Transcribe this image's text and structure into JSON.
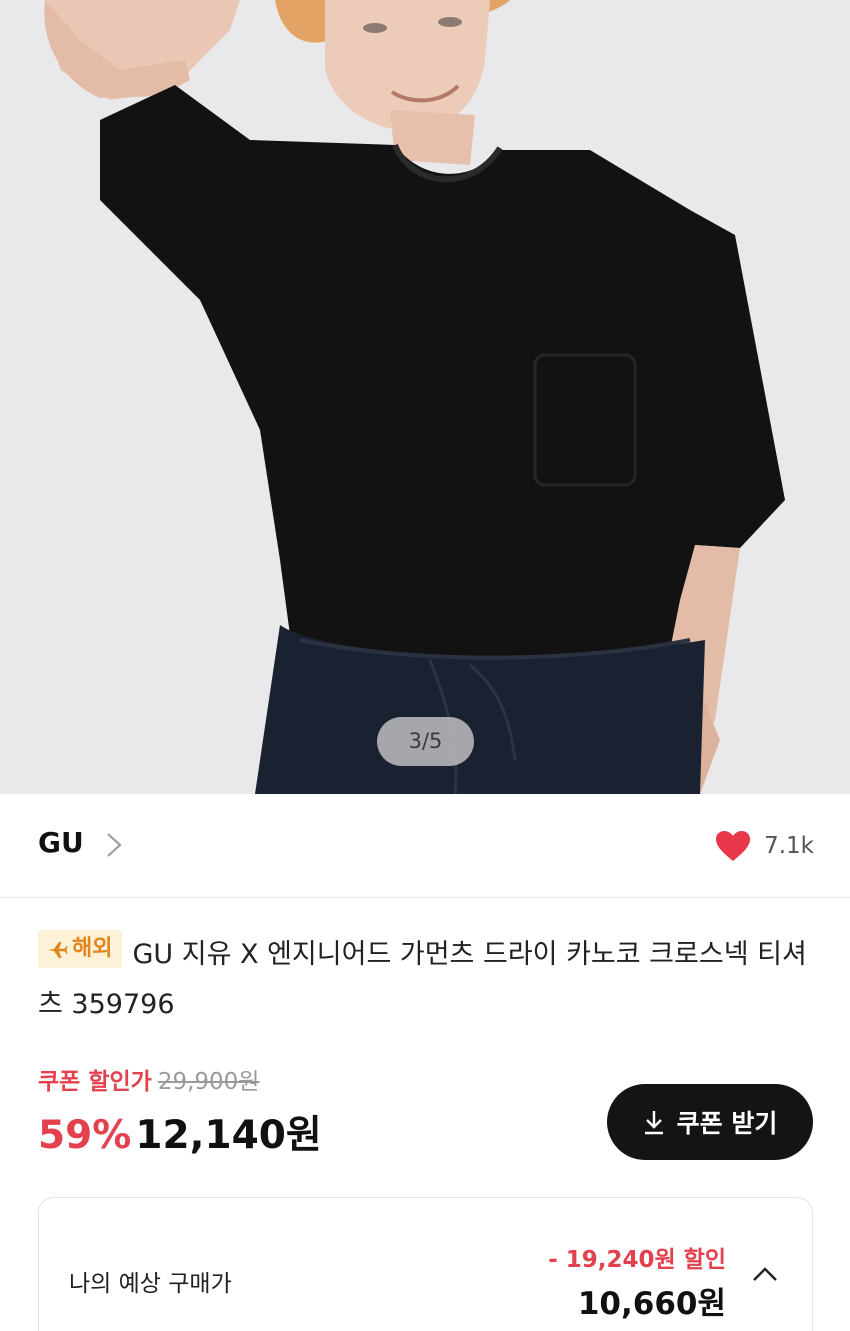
{
  "gallery": {
    "counter": "3/5"
  },
  "brand": {
    "name": "GU",
    "chevron_icon": "chevron-right-icon"
  },
  "likes": {
    "icon": "heart-icon",
    "count": "7.1k",
    "color": "#e8364a"
  },
  "product": {
    "badge_icon": "airplane-icon",
    "badge_label": "해외",
    "title": "GU 지유 X 엔지니어드 가먼츠 드라이 카노코 크로스넥 티셔츠 359796"
  },
  "price": {
    "coupon_label": "쿠폰 할인가",
    "original_price": "29,900원",
    "discount_rate": "59%",
    "final_price": "12,140원",
    "accent_color": "#e2414d"
  },
  "coupon_button": {
    "icon": "download-icon",
    "label": "쿠폰 받기"
  },
  "estimate": {
    "label": "나의 예상 구매가",
    "discount_text": "- 19,240원 할인",
    "price": "10,660원",
    "toggle_icon": "chevron-up-icon"
  }
}
